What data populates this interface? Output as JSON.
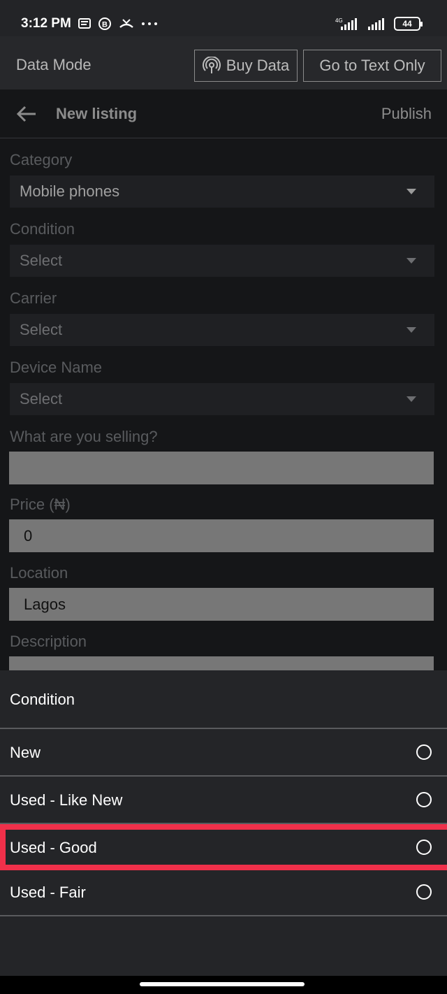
{
  "status_bar": {
    "time": "3:12 PM",
    "network": "4G",
    "battery": "44"
  },
  "data_bar": {
    "label": "Data Mode",
    "buy_data": "Buy Data",
    "text_only": "Go to Text Only"
  },
  "header": {
    "title": "New listing",
    "publish": "Publish"
  },
  "form": {
    "category_label": "Category",
    "category_value": "Mobile phones",
    "condition_label": "Condition",
    "condition_value": "Select",
    "carrier_label": "Carrier",
    "carrier_value": "Select",
    "device_label": "Device Name",
    "device_value": "Select",
    "selling_label": "What are you selling?",
    "selling_value": "",
    "price_label": "Price (₦)",
    "price_value": "0",
    "location_label": "Location",
    "location_value": "Lagos",
    "description_label": "Description"
  },
  "sheet": {
    "title": "Condition",
    "options": [
      {
        "label": "New",
        "selected": false
      },
      {
        "label": "Used - Like New",
        "selected": false
      },
      {
        "label": "Used - Good",
        "selected": false
      },
      {
        "label": "Used - Fair",
        "selected": false
      }
    ],
    "highlight_color": "#f0304a"
  }
}
